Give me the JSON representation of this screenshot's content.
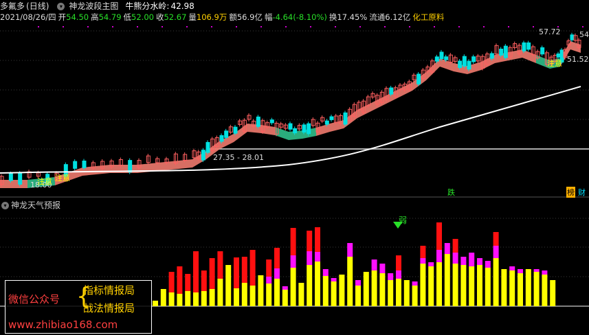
{
  "header": {
    "stock_name": "多氟多",
    "period": "(日线)",
    "indicator_name": "神龙波段主图",
    "water_label": "牛熊分水岭:",
    "water_value": "42.98",
    "date": "2021/08/26/四",
    "open_label": "开",
    "open": "54.50",
    "high_label": "高",
    "high": "54.79",
    "low_label": "低",
    "low": "52.00",
    "close_label": "收",
    "close": "52.67",
    "volume_label": "量",
    "volume": "106.9万",
    "amount_label": "额",
    "amount": "56.9亿",
    "change_label": "幅",
    "change": "-4.64(-8.10%)",
    "turnover_label": "换",
    "turnover": "17.45%",
    "float_label": "流通",
    "float": "6.12亿",
    "sector": "化工原料"
  },
  "main_chart": {
    "price_labels": {
      "high_mark": "57.72",
      "right_54": "54",
      "right_51": "51.52",
      "range_label": "27.35 - 28.01",
      "low_mark": "18.00"
    },
    "signals": {
      "attention_1": "注意",
      "attention_2": "注意",
      "attention_3": "注意",
      "fall": "跌",
      "rank": "榜",
      "finance": "财"
    },
    "colors": {
      "up": "#ff6060",
      "down": "#00e0e0",
      "band_up": "#f07a6e",
      "band_down": "#2fbf8a",
      "long_ma": "#ffffff",
      "dots": "#d000d0"
    }
  },
  "sub_chart": {
    "title": "神龙天气预报",
    "weak_label": "弱",
    "colors": {
      "red": "#ff1010",
      "magenta": "#ff10ff",
      "yellow": "#ffff00",
      "cyan": "#00e0ff"
    }
  },
  "watermark": {
    "wechat": "微信公众号",
    "line1": "指标情报局",
    "line2": "战法情报局",
    "url": "www.zhibiao168.com"
  }
}
